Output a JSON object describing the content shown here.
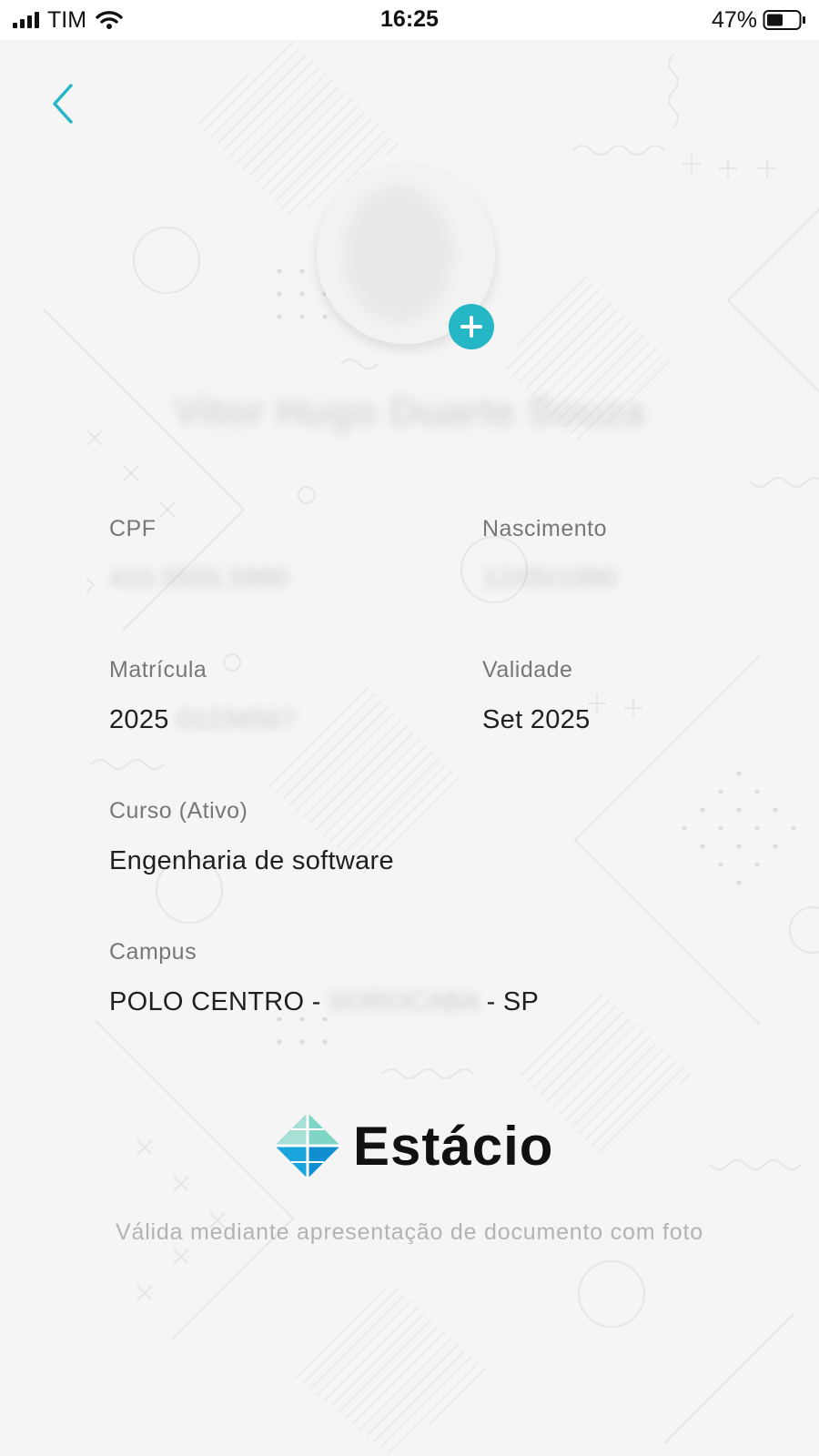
{
  "status_bar": {
    "carrier": "TIM",
    "time": "16:25",
    "battery": "47%"
  },
  "profile": {
    "name": "Vitor Hugo Duarte Souza"
  },
  "fields": {
    "cpf": {
      "label": "CPF",
      "value": "410.5555.5990"
    },
    "birth": {
      "label": "Nascimento",
      "value": "12/05/1990"
    },
    "enrollment": {
      "label": "Matrícula",
      "value": "2025",
      "value_hidden": "01234567"
    },
    "validity": {
      "label": "Validade",
      "value": "Set 2025"
    },
    "course": {
      "label": "Curso (Ativo)",
      "value": "Engenharia de software"
    },
    "campus": {
      "label": "Campus",
      "value_prefix": "POLO CENTRO -",
      "value_hidden": "SOROCABA",
      "value_suffix": "- SP"
    }
  },
  "brand": {
    "name": "Estácio"
  },
  "disclaimer": "Válida mediante apresentação de documento com foto",
  "colors": {
    "accent": "#26b7c7",
    "background": "#f5f5f5"
  }
}
